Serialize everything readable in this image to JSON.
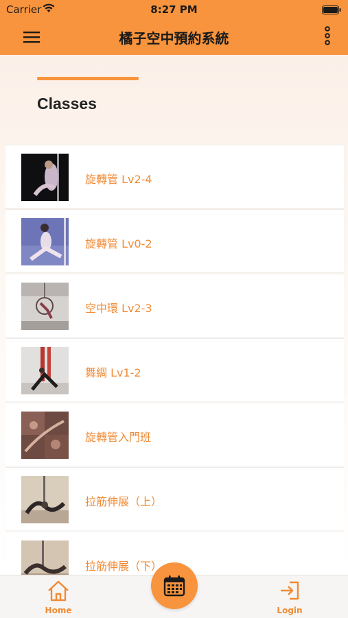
{
  "status_bar": {
    "carrier": "Carrier",
    "time": "8:27 PM"
  },
  "navbar": {
    "title": "橘子空中預約系統"
  },
  "section": {
    "title": "Classes"
  },
  "classes": [
    {
      "name": "旋轉管 Lv2-4"
    },
    {
      "name": "旋轉管 Lv0-2"
    },
    {
      "name": "空中環 Lv2-3"
    },
    {
      "name": "舞綢 Lv1-2"
    },
    {
      "name": "旋轉管入門班"
    },
    {
      "name": "拉筋伸展（上）"
    },
    {
      "name": "拉筋伸展（下）"
    }
  ],
  "tabbar": {
    "home_label": "Home",
    "login_label": "Login"
  },
  "colors": {
    "accent": "#f7943d",
    "text_accent": "#f08a34"
  }
}
